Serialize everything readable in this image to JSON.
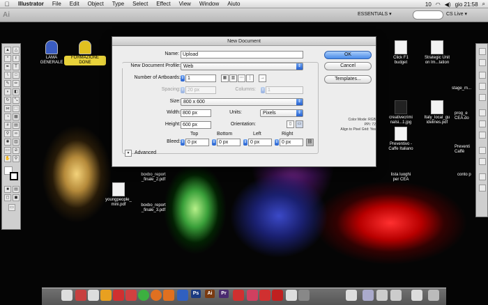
{
  "menubar": {
    "app": "Illustrator",
    "items": [
      "File",
      "Edit",
      "Object",
      "Type",
      "Select",
      "Effect",
      "View",
      "Window",
      "Aiuto"
    ],
    "status_num": "10",
    "clock": "gio 21:58"
  },
  "appbar": {
    "workspace": "ESSENTIALS ▾",
    "cs_live": "CS Live ▾"
  },
  "desktop": {
    "left_icons": [
      {
        "label": "LAMA\nGENERALE"
      },
      {
        "label": "FORMAZIONE\nDONE"
      }
    ],
    "mid_icons": [
      {
        "label": "youngpeople_\nmini.pdf"
      },
      {
        "label": "boxbo_report\n_finale_3.pdf"
      },
      {
        "label": "boxbo_report\n_finale_2.pdf"
      }
    ],
    "right_icons": [
      {
        "label": "Click F1\nbudget"
      },
      {
        "label": "Strategic Unit\non lm...tation"
      },
      {
        "label": "creativecrimi\nnalsi...1.jpg"
      },
      {
        "label": "Italy_local_gu\nidelines.pdf"
      },
      {
        "label": "Preventivo -\nCaffe Italiano"
      },
      {
        "label": "lista luoghi\nper CEA"
      }
    ],
    "far_right_labels": [
      "stage_m...",
      "prog_e\nCEA.do",
      "Preventi\nCaffè",
      "conto p"
    ]
  },
  "dialog": {
    "title": "New Document",
    "name_label": "Name:",
    "name_value": "Upload",
    "profile_label": "New Document Profile:",
    "profile_value": "Web",
    "artboards_label": "Number of Artboards:",
    "artboards_value": "1",
    "spacing_label": "Spacing:",
    "spacing_value": "20 px",
    "columns_label": "Columns:",
    "columns_value": "1",
    "size_label": "Size:",
    "size_value": "800 x 600",
    "width_label": "Width:",
    "width_value": "800 px",
    "units_label": "Units:",
    "units_value": "Pixels",
    "height_label": "Height:",
    "height_value": "600 px",
    "orientation_label": "Orientation:",
    "bleed_label": "Bleed:",
    "bleed_headers": [
      "Top",
      "Bottom",
      "Left",
      "Right"
    ],
    "bleed_values": [
      "0 px",
      "0 px",
      "0 px",
      "0 px"
    ],
    "advanced_label": "Advanced",
    "ok_label": "OK",
    "cancel_label": "Cancel",
    "templates_label": "Templates...",
    "info_lines": [
      "Color Mode: RGB",
      "PPI: 72",
      "Align to Pixel Grid: Yes"
    ]
  },
  "dock": {
    "ps": "Ps",
    "ai": "Ai",
    "pr": "Pr"
  },
  "colors": {
    "accent": "#2560d0",
    "desktop_bg": "#050505"
  }
}
